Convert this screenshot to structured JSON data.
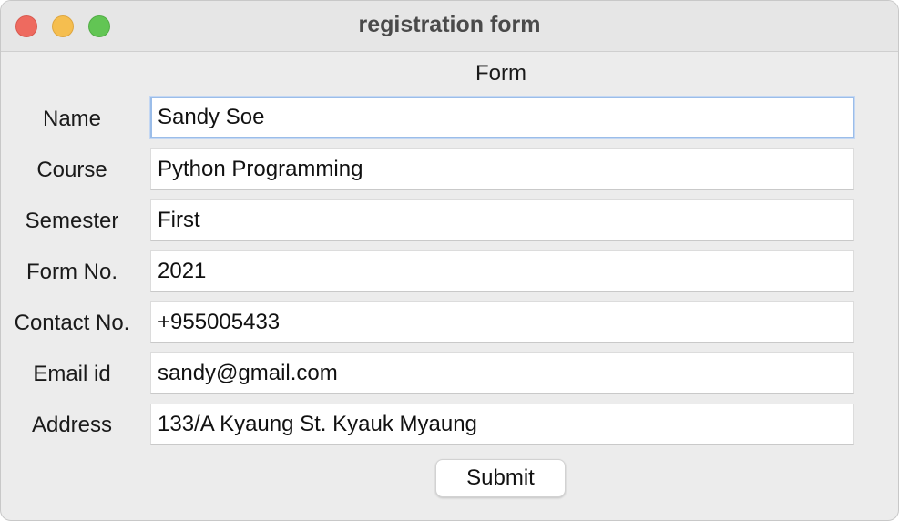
{
  "window": {
    "title": "registration form"
  },
  "form": {
    "heading": "Form",
    "fields": [
      {
        "label": "Name",
        "value": "Sandy Soe"
      },
      {
        "label": "Course",
        "value": "Python Programming"
      },
      {
        "label": "Semester",
        "value": "First"
      },
      {
        "label": "Form No.",
        "value": "2021"
      },
      {
        "label": "Contact No.",
        "value": "+955005433"
      },
      {
        "label": "Email id",
        "value": "sandy@gmail.com"
      },
      {
        "label": "Address",
        "value": "133/A Kyaung St. Kyauk Myaung"
      }
    ],
    "submit_label": "Submit"
  },
  "colors": {
    "close": "#ee6a5f",
    "minimize": "#f5be4f",
    "maximize": "#62c554",
    "focus_ring": "#9bbde9"
  }
}
